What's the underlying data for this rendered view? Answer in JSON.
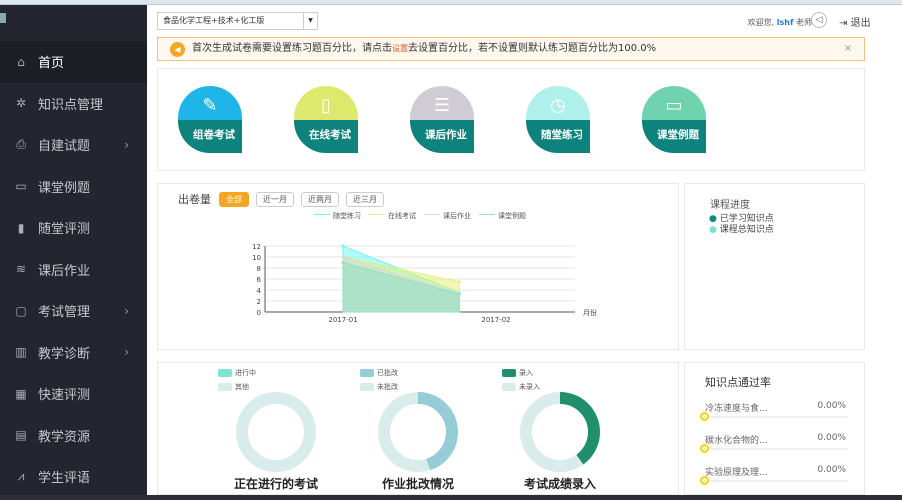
{
  "sidebar": {
    "items": [
      {
        "label": "首页",
        "icon": "home-icon"
      },
      {
        "label": "知识点管理",
        "icon": "gear-icon"
      },
      {
        "label": "自建试题",
        "icon": "printer-icon",
        "chevron": true
      },
      {
        "label": "课堂例题",
        "icon": "board-icon"
      },
      {
        "label": "随堂评测",
        "icon": "chart-icon"
      },
      {
        "label": "课后作业",
        "icon": "layers-icon"
      },
      {
        "label": "考试管理",
        "icon": "exam-icon",
        "chevron": true
      },
      {
        "label": "教学诊断",
        "icon": "bar-chart-icon",
        "chevron": true
      },
      {
        "label": "快速评测",
        "icon": "grid-icon"
      },
      {
        "label": "教学资源",
        "icon": "file-icon"
      },
      {
        "label": "学生评语",
        "icon": "line-chart-icon"
      }
    ]
  },
  "header": {
    "course_select": "食品化学工程+技术+化工版",
    "welcome": "欢迎您,",
    "username": "lshf",
    "role": "老师",
    "logout": "退出"
  },
  "alert": {
    "text_before": "首次生成试卷需要设置练习题百分比，请点击",
    "link": "设置",
    "text_after": "去设置百分比，若不设置则默认练习题百分比为100.0%",
    "close": "×"
  },
  "tiles": [
    {
      "label": "组卷考试",
      "color": "#1fb5e8",
      "glyph": "✎"
    },
    {
      "label": "在线考试",
      "color": "#dde96c",
      "glyph": "▯"
    },
    {
      "label": "课后作业",
      "color": "#cfccd6",
      "glyph": "☰"
    },
    {
      "label": "随堂练习",
      "color": "#b0f0ea",
      "glyph": "◷"
    },
    {
      "label": "课堂例题",
      "color": "#6fd3b0",
      "glyph": "▭"
    }
  ],
  "chart_panel": {
    "title": "出卷量",
    "ranges": [
      "全部",
      "近一月",
      "近两月",
      "近三月"
    ]
  },
  "chart_data": {
    "type": "area",
    "categories": [
      "2017-01",
      "2017-02"
    ],
    "xlabel": "月份",
    "ylim": [
      0,
      12
    ],
    "yticks": [
      0,
      2,
      4,
      6,
      8,
      10,
      12
    ],
    "series": [
      {
        "name": "随堂练习",
        "color": "#6ff5f0",
        "x": [
          0,
          0.76
        ],
        "values": [
          12,
          3.5
        ]
      },
      {
        "name": "在线考试",
        "color": "#e5ef7a",
        "x": [
          0,
          0.76
        ],
        "values": [
          10,
          5.5
        ]
      },
      {
        "name": "课后作业",
        "color": "#d8d8d8",
        "x": [
          0,
          0.76
        ],
        "values": [
          10,
          3.3
        ]
      },
      {
        "name": "课堂例题",
        "color": "#8fe0c8",
        "x": [
          0,
          0.76
        ],
        "values": [
          9,
          3.3
        ]
      }
    ]
  },
  "progress": {
    "title": "课程进度",
    "legend": [
      {
        "label": "已学习知识点",
        "color": "#0e8a82"
      },
      {
        "label": "课程总知识点",
        "color": "#7ee0d2"
      }
    ]
  },
  "donuts": [
    {
      "title": "正在进行的考试",
      "legend": [
        "进行中",
        "其他"
      ],
      "colors": [
        "#7fe3d4",
        "#d9ecec"
      ],
      "fraction": 0
    },
    {
      "title": "作业批改情况",
      "legend": [
        "已批改",
        "未批改"
      ],
      "colors": [
        "#95ccd6",
        "#d9ecec"
      ],
      "fraction": 0.45
    },
    {
      "title": "考试成绩录入",
      "legend": [
        "录入",
        "未录入"
      ],
      "colors": [
        "#218e6c",
        "#d9ecec"
      ],
      "fraction": 0.4
    }
  ],
  "pass_rate": {
    "title": "知识点通过率",
    "items": [
      {
        "name": "冷冻速度与食...",
        "value": "0.00%"
      },
      {
        "name": "碳水化合物的...",
        "value": "0.00%"
      },
      {
        "name": "实验原理及理...",
        "value": "0.00%"
      }
    ]
  }
}
